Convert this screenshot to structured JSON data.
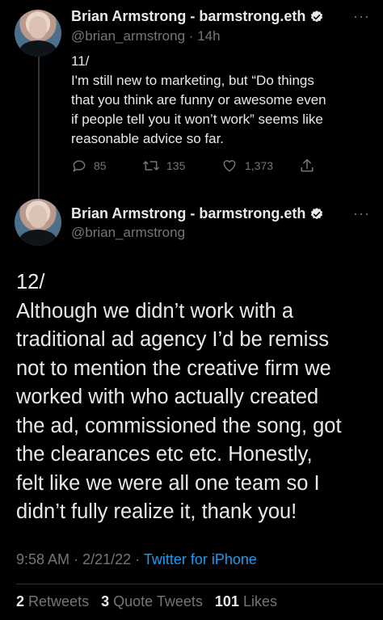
{
  "tweet1": {
    "author_name": "Brian Armstrong - barmstrong.eth",
    "handle": "@brian_armstrong",
    "separator": "·",
    "time": "14h",
    "more": "···",
    "text_lines": [
      "11/",
      "I'm still new to marketing, but “Do things",
      "that you think are funny or awesome even",
      "if people tell you it won’t work” seems like",
      "reasonable advice so far."
    ],
    "replies": "85",
    "retweets": "135",
    "likes": "1,373"
  },
  "tweet2": {
    "author_name": "Brian Armstrong - barmstrong.eth",
    "handle": "@brian_armstrong",
    "more": "···",
    "text_lines": [
      "12/",
      "Although we didn’t work with a",
      "traditional ad agency I’d be remiss",
      "not to mention the creative firm we",
      "worked with who actually created",
      "the ad, commissioned the song, got",
      "the clearances etc etc. Honestly,",
      "felt like we were all one team so I",
      "didn’t fully realize it, thank you!"
    ],
    "time": "9:58 AM",
    "date": "2/21/22",
    "separator": "·",
    "source": "Twitter for iPhone",
    "retweets_count": "2",
    "retweets_label": "Retweets",
    "quotes_count": "3",
    "quotes_label": "Quote Tweets",
    "likes_count": "101",
    "likes_label": "Likes"
  },
  "colors": {
    "background": "#000000",
    "text": "#e7e9ea",
    "muted": "#71767b",
    "link": "#1d9bf0"
  }
}
